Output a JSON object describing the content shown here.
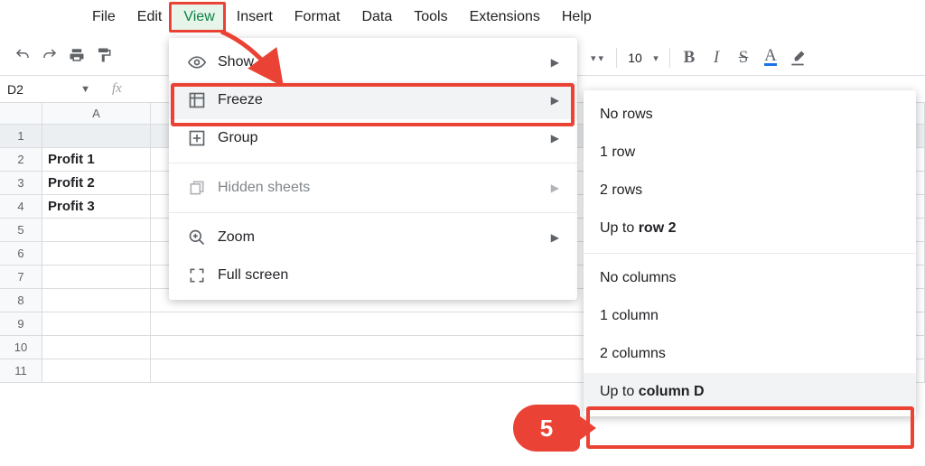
{
  "menubar": [
    "File",
    "Edit",
    "View",
    "Insert",
    "Format",
    "Data",
    "Tools",
    "Extensions",
    "Help"
  ],
  "menubar_active_index": 2,
  "toolbar": {
    "font_size": "10"
  },
  "name_box": "D2",
  "columns": [
    "A"
  ],
  "rows": [
    {
      "n": "1",
      "a": ""
    },
    {
      "n": "2",
      "a": "Profit 1"
    },
    {
      "n": "3",
      "a": "Profit 2"
    },
    {
      "n": "4",
      "a": "Profit 3"
    },
    {
      "n": "5",
      "a": ""
    },
    {
      "n": "6",
      "a": ""
    },
    {
      "n": "7",
      "a": ""
    },
    {
      "n": "8",
      "a": ""
    },
    {
      "n": "9",
      "a": ""
    },
    {
      "n": "10",
      "a": ""
    },
    {
      "n": "11",
      "a": ""
    }
  ],
  "view_menu": {
    "show": "Show",
    "freeze": "Freeze",
    "group": "Group",
    "hidden": "Hidden sheets",
    "zoom": "Zoom",
    "fullscreen": "Full screen"
  },
  "freeze_menu": {
    "no_rows": "No rows",
    "one_row": "1 row",
    "two_rows": "2 rows",
    "up_to_row_pre": "Up to ",
    "up_to_row_bold": "row 2",
    "no_cols": "No columns",
    "one_col": "1 column",
    "two_cols": "2 columns",
    "up_to_col_pre": "Up to ",
    "up_to_col_bold": "column D"
  },
  "annotation": {
    "step": "5"
  }
}
